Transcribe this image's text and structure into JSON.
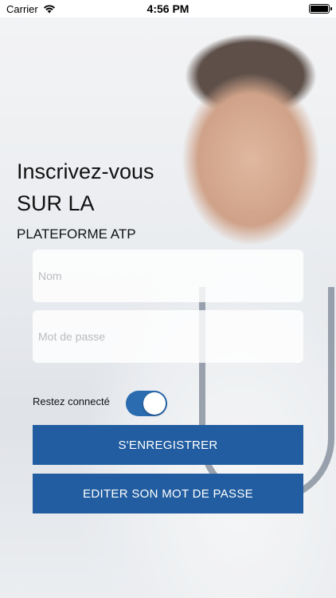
{
  "status_bar": {
    "carrier": "Carrier",
    "time": "4:56 PM",
    "wifi_icon": "wifi-icon",
    "battery_icon": "battery-icon"
  },
  "header": {
    "title_line1": "Inscrivez-vous",
    "title_line2": "SUR LA",
    "subtitle": "PLATEFORME ATP"
  },
  "form": {
    "name_placeholder": "Nom",
    "name_value": "",
    "password_placeholder": "Mot de passe",
    "password_value": "",
    "remember_label": "Restez connecté",
    "remember_on": true
  },
  "buttons": {
    "register": "S'ENREGISTRER",
    "edit_password": "EDITER SON MOT DE PASSE"
  },
  "colors": {
    "primary": "#215da0",
    "toggle_on": "#2b6cb0"
  }
}
